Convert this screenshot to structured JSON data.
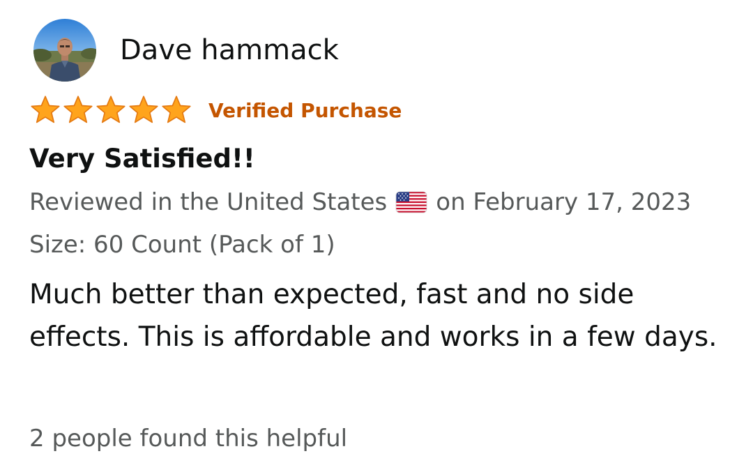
{
  "reviewer": {
    "name": "Dave hammack"
  },
  "rating": {
    "stars": 5,
    "max": 5,
    "star_color": "#ff9900",
    "star_outline": "#e47911"
  },
  "badge": {
    "verified_label": "Verified Purchase",
    "color": "#c45500"
  },
  "review": {
    "title": "Very Satisfied!!",
    "date_prefix": "Reviewed in the United States",
    "date_flag": "us-flag-icon",
    "date_suffix": "on February 17, 2023",
    "variant": "Size: 60 Count (Pack of 1)",
    "body": "Much better than expected, fast and no side effects. This is affordable and works in a few days.",
    "helpful": "2 people found this helpful"
  }
}
